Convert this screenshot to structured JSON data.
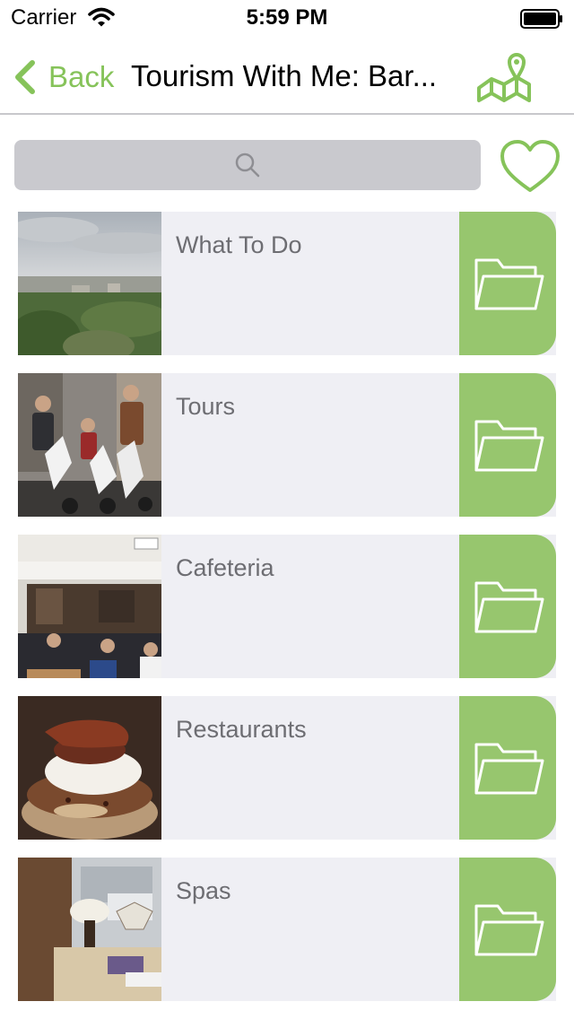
{
  "status_bar": {
    "carrier": "Carrier",
    "time": "5:59 PM"
  },
  "nav": {
    "back_label": "Back",
    "title": "Tourism With Me: Bar..."
  },
  "search": {
    "placeholder": ""
  },
  "colors": {
    "accent": "#86c35a",
    "folder_bg": "#97c66e",
    "row_bg": "#efeff4",
    "search_bg": "#c9c9ce"
  },
  "categories": [
    {
      "label": "What To Do",
      "thumb": "city-view-photo",
      "icon": "folder-icon"
    },
    {
      "label": "Tours",
      "thumb": "scooter-tour-photo",
      "icon": "folder-icon"
    },
    {
      "label": "Cafeteria",
      "thumb": "cafe-interior-photo",
      "icon": "folder-icon"
    },
    {
      "label": "Restaurants",
      "thumb": "burger-photo",
      "icon": "folder-icon"
    },
    {
      "label": "Spas",
      "thumb": "spa-interior-photo",
      "icon": "folder-icon"
    }
  ]
}
